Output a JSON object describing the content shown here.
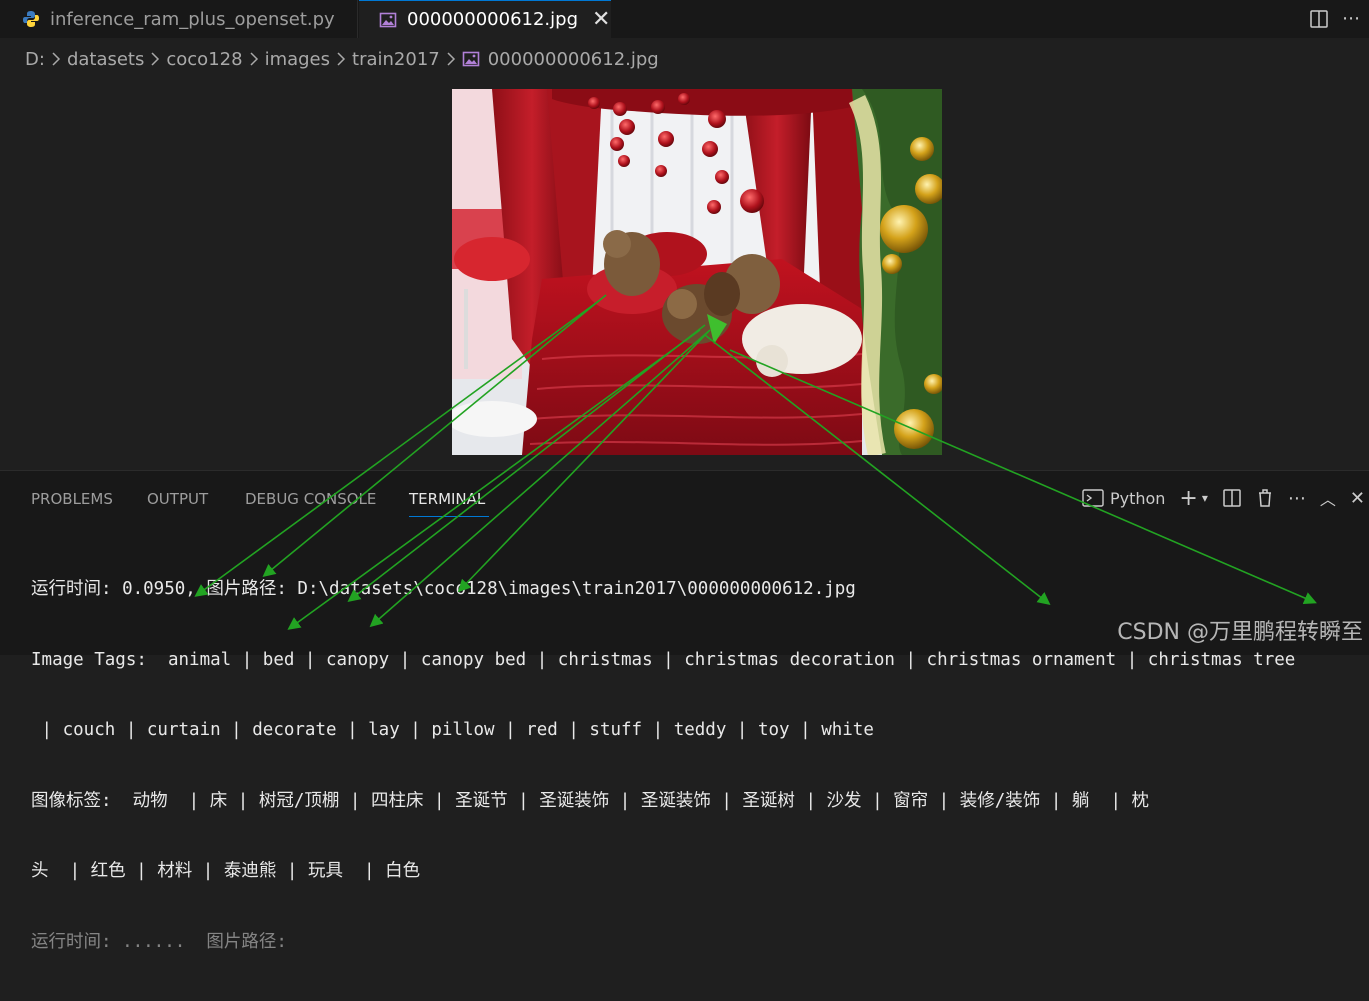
{
  "tabs": [
    {
      "label": "inference_ram_plus_openset.py",
      "icon": "python-icon",
      "active": false
    },
    {
      "label": "000000000612.jpg",
      "icon": "image-file-icon",
      "active": true
    }
  ],
  "breadcrumb": [
    "D:",
    "datasets",
    "coco128",
    "images",
    "train2017",
    "000000000612.jpg"
  ],
  "panel": {
    "tabs": [
      "PROBLEMS",
      "OUTPUT",
      "DEBUG CONSOLE",
      "TERMINAL"
    ],
    "active_tab": "TERMINAL",
    "terminal_profile": "Python"
  },
  "terminal": {
    "lines": [
      "运行时间: 0.0950, 图片路径: D:\\datasets\\coco128\\images\\train2017\\000000000612.jpg",
      "Image Tags:  animal | bed | canopy | canopy bed | christmas | christmas decoration | christmas ornament | christmas tree",
      " | couch | curtain | decorate | lay | pillow | red | stuff | teddy | toy | white",
      "图像标签:  动物  | 床 | 树冠/顶棚 | 四柱床 | 圣诞节 | 圣诞装饰 | 圣诞装饰 | 圣诞树 | 沙发 | 窗帘 | 装修/装饰 | 躺  | 枕",
      "头  | 红色 | 材料 | 泰迪熊 | 玩具  | 白色",
      "运行时间: ......  图片路径:"
    ]
  },
  "watermark": "CSDN @万里鹏程转瞬至",
  "colors": {
    "accent": "#0078d4",
    "arrow": "#22a322",
    "editor_bg": "#1f1f1f",
    "panel_bg": "#181818"
  }
}
